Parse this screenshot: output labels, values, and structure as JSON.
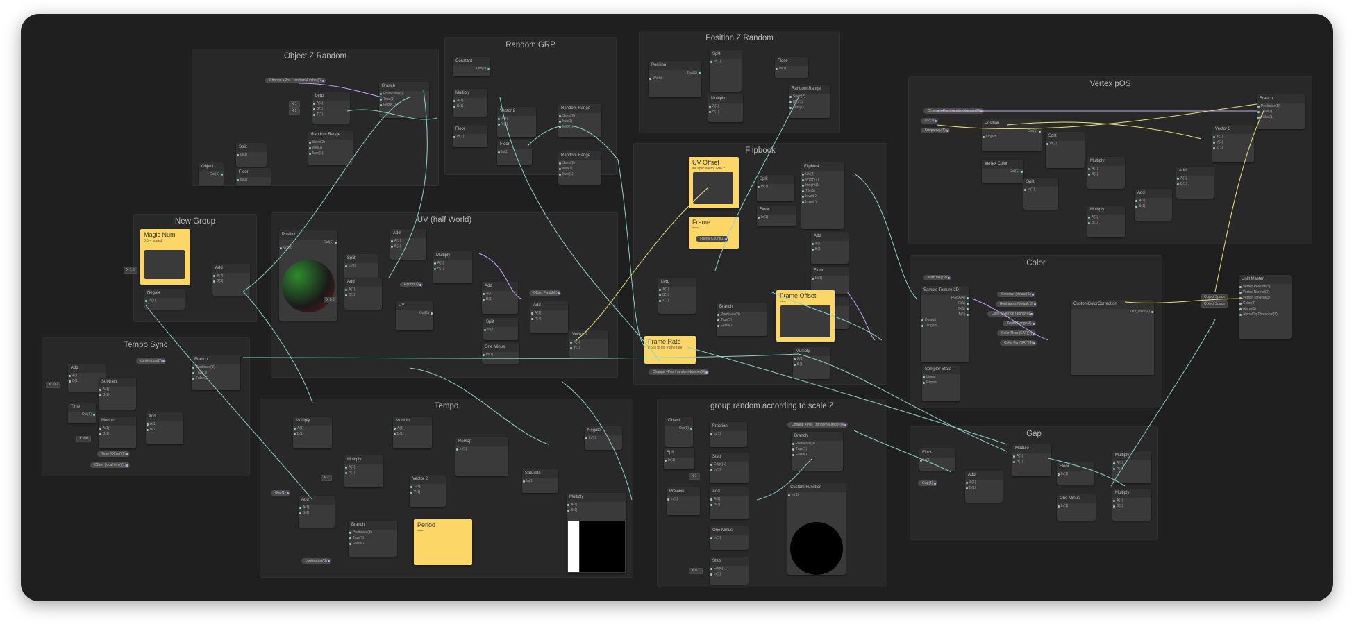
{
  "groups": [
    {
      "title": "Object Z Random"
    },
    {
      "title": "Random GRP"
    },
    {
      "title": "Position Z Random"
    },
    {
      "title": "Vertex pOS"
    },
    {
      "title": "Flipbook"
    },
    {
      "title": "New Group"
    },
    {
      "title": "UV (half World)"
    },
    {
      "title": "Tempo Sync"
    },
    {
      "title": "Color"
    },
    {
      "title": "Tempo"
    },
    {
      "title": "group random according to  scale Z"
    },
    {
      "title": "Gap"
    }
  ],
  "stickies": {
    "magic_num": {
      "title": "Magic Num",
      "body": "0.5 = speed"
    },
    "uv_offset": {
      "title": "UV Offset",
      "body": "== speclals for with 2"
    },
    "frame": {
      "title": "Frame",
      "body": "==="
    },
    "frame_offset": {
      "title": "Frame Offset",
      "body": "==="
    },
    "frame_rate": {
      "title": "Frame Rate",
      "body": "0.5 is to flip frame rate"
    },
    "period": {
      "title": "Period",
      "body": "==="
    }
  },
  "pills": {
    "change_ofss_z": "Change +Pos / randomNumber(0)",
    "change_ofss_vertex": "Change +Pos / randomNumber(0)",
    "change_ofss_flip": "Change +Pos / randomNumber(0)",
    "change_ofss_group": "Change +Pos / randomNumber(0)",
    "continuous": "continuous(B)",
    "continuous2": "continuous(B)",
    "offset_pwidth": "Offset Pwidth(t)",
    "frame_count": "Frame Count(1)",
    "rounds": "Round(1)",
    "uv_pill": "UV(1)",
    "frequency": "Frequency(1)",
    "maintex": "MainTex(T2)",
    "contrast": "Contrast (default 1)",
    "brightness": "Brightness (default 0)",
    "color_override": "Color Override (alpha=0)",
    "depth_range": "Depth Range(4)",
    "color_near": "Color Near (SAT)(4)",
    "color_far": "Color Far (SAT)(4)",
    "gap": "Gap(1)",
    "time_offset": "Time (Offset)(1)",
    "offset_time": "Offset (local time)(1)",
    "gap_time": "Gap(1)"
  },
  "nodes": {
    "branch": "Branch",
    "lerp": "Lerp",
    "split": "Split",
    "floor": "Floor",
    "random_range": "Random Range",
    "object": "Object",
    "constant": "Constant",
    "multiply": "Multiply",
    "vector2": "Vector 2",
    "vector3": "Vector 3",
    "position": "Position",
    "flipbook": "Flipbook",
    "add": "Add",
    "negate": "Negate",
    "uv": "UV",
    "one_minus": "One Minus",
    "subtract": "Subtract",
    "modulo": "Modulo",
    "time": "Time",
    "remap": "Remap",
    "saturate": "Saturate",
    "step": "Step",
    "preview": "Preview",
    "custom_function": "Custom Function",
    "vertex_color": "Vertex Color",
    "sample_texture": "Sample Texture 2D",
    "sampler_state": "Sampler State",
    "custom_color": "CustomColorCorrection",
    "unlit_master": "Unlit Master",
    "fraction": "Fraction"
  },
  "ports": {
    "a": "A(1)",
    "b": "B(1)",
    "t": "T(1)",
    "out": "Out(1)",
    "in": "In(1)",
    "predicate": "Predicate(B)",
    "true": "True(1)",
    "false": "False(1)",
    "seed": "Seed(2)",
    "min": "Min(1)",
    "max": "Max(1)",
    "r": "R(1)",
    "g": "G(1)",
    "bch": "B(1)",
    "x": "X(1)",
    "y": "Y(1)",
    "z": "Z(1)",
    "uv": "UV(4)",
    "width": "Width(1)",
    "height": "Height(1)",
    "tile": "Tile(1)",
    "invert_x": "Invert X",
    "invert_y": "Invert Y",
    "edge": "Edge(1)",
    "vertex_position": "Vertex Position(3)",
    "vertex_normal": "Vertex Normal(3)",
    "vertex_tangent": "Vertex Tangent(3)",
    "color": "Color(3)",
    "alpha": "Alpha(1)",
    "alpha_clip": "AlphaClipThreshold(1)",
    "out_color": "Out_color(4)",
    "rgba": "RGBA(4)"
  },
  "consts": {
    "k1": "X  1",
    "k2": "X  2",
    "k3": "X  1.5",
    "k4": "X  0.6",
    "k5": "X  100",
    "k6": "X  3",
    "k7": "X  100",
    "k8": "X  -32",
    "k9": "X  20",
    "k10": "X  0.7",
    "k11": "X  1",
    "k12": "X  6",
    "k13": "X  2"
  },
  "dropdowns": {
    "space_world": "World",
    "space_object": "Object",
    "type_default": "Default",
    "space_tangent": "Tangent",
    "filter_linear": "Linear",
    "wrap_repeat": "Repeat",
    "object_space1": "Object Space",
    "object_space2": "Object Space"
  },
  "colors": {
    "canvas": "#1f1f1f",
    "group": "#282828",
    "node": "#3a3a3a",
    "sticky": "#fcd667",
    "wire_cyan": "#8ed3c8",
    "wire_yellow": "#e8e27a",
    "wire_purple": "#c9a4ff"
  }
}
